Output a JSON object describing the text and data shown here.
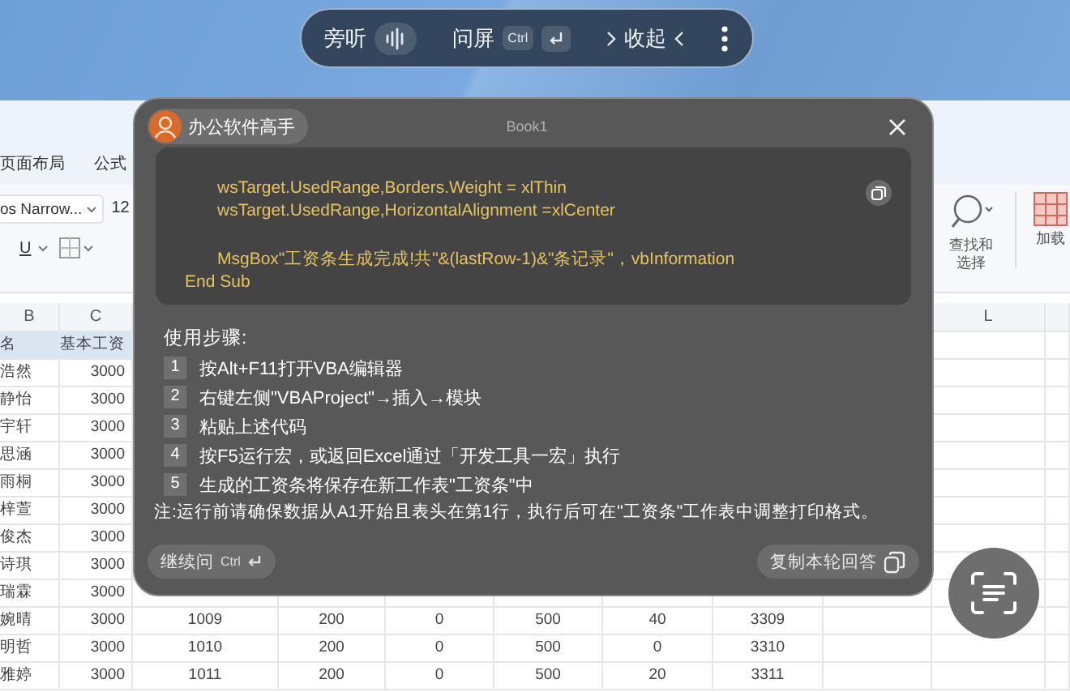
{
  "toolbar": {
    "listen": "旁听",
    "ask": "问屏",
    "ask_key": "Ctrl",
    "collapse": "收起"
  },
  "excel": {
    "tabs": [
      "页面布局",
      "公式"
    ],
    "font_name": "os Narrow...",
    "font_size": "12",
    "underline": "U",
    "find_select": "查找和选择",
    "addins": "加载",
    "columns_left": [
      "B",
      "C"
    ],
    "columns_right": [
      "L"
    ],
    "header": [
      "名",
      "基本工资"
    ],
    "rows": [
      {
        "name": "浩然",
        "values": [
          "3000"
        ]
      },
      {
        "name": "静怡",
        "values": [
          "3000"
        ]
      },
      {
        "name": "宇轩",
        "values": [
          "3000"
        ]
      },
      {
        "name": "思涵",
        "values": [
          "3000"
        ]
      },
      {
        "name": "雨桐",
        "values": [
          "3000"
        ]
      },
      {
        "name": "梓萱",
        "values": [
          "3000"
        ]
      },
      {
        "name": "俊杰",
        "values": [
          "3000"
        ]
      },
      {
        "name": "诗琪",
        "values": [
          "3000"
        ]
      },
      {
        "name": "瑞霖",
        "values": [
          "3000"
        ]
      },
      {
        "name": "婉晴",
        "values": [
          "3000",
          "1009",
          "200",
          "0",
          "500",
          "40",
          "3309"
        ]
      },
      {
        "name": "明哲",
        "values": [
          "3000",
          "1010",
          "200",
          "0",
          "500",
          "0",
          "3310"
        ]
      },
      {
        "name": "雅婷",
        "values": [
          "3000",
          "1011",
          "200",
          "0",
          "500",
          "20",
          "3311"
        ]
      }
    ]
  },
  "panel": {
    "assistant": "办公软件高手",
    "title": "Book1",
    "code_lines": [
      {
        "text": "wsTarget.UsedRange,Borders.Weight = xlThin",
        "indent": true,
        "gap_before": false
      },
      {
        "text": "wsTarget.UsedRange,HorizontalAlignment =xlCenter",
        "indent": true,
        "gap_before": false
      },
      {
        "text": "MsgBox\"工资条生成完成!共\"&(lastRow-1)&\"条记录\"，vbInformation",
        "indent": true,
        "gap_before": true
      },
      {
        "text": "End Sub",
        "indent": false,
        "gap_before": false
      }
    ],
    "steps_title": "使用步骤:",
    "steps": [
      {
        "number": "1",
        "text": "按Alt+F11打开VBA编辑器"
      },
      {
        "number": "2",
        "text": "右键左侧\"VBAProject\"→插入→模块"
      },
      {
        "number": "3",
        "text": "粘贴上述代码"
      },
      {
        "number": "4",
        "text": "按F5运行宏，或返回Excel通过「开发工具一宏」执行"
      },
      {
        "number": "5",
        "text": "生成的工资条将保存在新工作表\"工资条\"中"
      }
    ],
    "note": "注:运行前请确保数据从A1开始且表头在第1行，执行后可在\"工资条\"工作表中调整打印格式。",
    "continue_label": "继续问",
    "continue_key": "Ctrl",
    "copy_label": "复制本轮回答"
  }
}
